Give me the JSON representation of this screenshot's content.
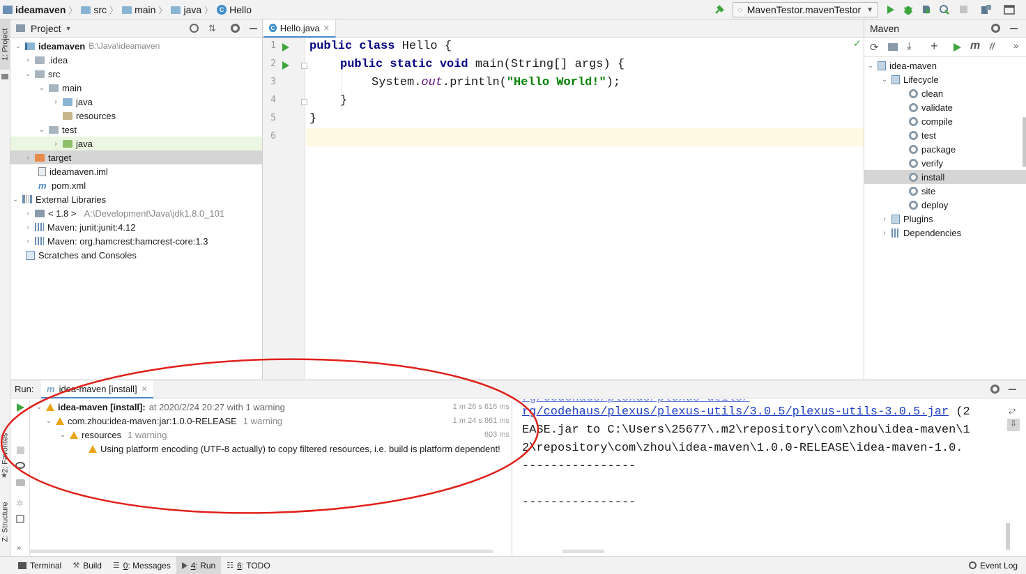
{
  "nav": {
    "project": "ideamaven",
    "crumbs": [
      "src",
      "main",
      "java",
      "Hello"
    ],
    "run_config": "MavenTestor.mavenTestor"
  },
  "left_tabs": {
    "project": "1: Project",
    "favorites": "2: Favorites",
    "structure": "Z: Structure"
  },
  "project_panel": {
    "title": "Project",
    "root": {
      "name": "ideamaven",
      "path": "B:\\Java\\ideamaven"
    },
    "items": {
      "idea": ".idea",
      "src": "src",
      "main": "main",
      "java": "java",
      "resources": "resources",
      "test": "test",
      "test_java": "java",
      "target": "target",
      "iml": "ideamaven.iml",
      "pom": "pom.xml",
      "extlib": "External Libraries",
      "jdk": "< 1.8 >",
      "jdk_path": "A:\\Development\\Java\\jdk1.8.0_101",
      "junit": "Maven: junit:junit:4.12",
      "hamcrest": "Maven: org.hamcrest:hamcrest-core:1.3",
      "scratches": "Scratches and Consoles"
    }
  },
  "editor": {
    "tab": "Hello.java",
    "line_numbers": [
      "1",
      "2",
      "3",
      "4",
      "5",
      "6"
    ],
    "code": {
      "l1_kw": "public class",
      "l1_rest": " Hello {",
      "l2_kw": "public static void",
      "l2_rest": " main(String[] args) {",
      "l3_a": "System.",
      "l3_field": "out",
      "l3_b": ".println(",
      "l3_str": "\"Hello World!\"",
      "l3_c": ");",
      "l4": "}",
      "l5": "}"
    }
  },
  "maven_panel": {
    "title": "Maven",
    "project": "idea-maven",
    "lifecycle": "Lifecycle",
    "phases": [
      "clean",
      "validate",
      "compile",
      "test",
      "package",
      "verify",
      "install",
      "site",
      "deploy"
    ],
    "selected": "install",
    "plugins": "Plugins",
    "dependencies": "Dependencies"
  },
  "run": {
    "label": "Run:",
    "tab": "idea-maven [install]",
    "rows": {
      "r1_bold": "idea-maven [install]:",
      "r1_rest": "at 2020/2/24 20:27 with 1 warning",
      "r1_time": "1 m 26 s 616 ms",
      "r2": "com.zhou:idea-maven:jar:1.0.0-RELEASE",
      "r2_note": "1 warning",
      "r2_time": "1 m 24 s 861 ms",
      "r3": "resources",
      "r3_note": "1 warning",
      "r3_time": "603 ms",
      "r4": "Using platform encoding (UTF-8 actually) to copy filtered resources, i.e. build is platform dependent!"
    },
    "console": {
      "c1": "rg/codehaus/plexus/plexus-utils/3.0.5/plexus-utils-3.0.5.jar",
      "c1_tail": " (2",
      "c2": "EASE.jar to C:\\Users\\25677\\.m2\\repository\\com\\zhou\\idea-maven\\1",
      "c3": "2\\repository\\com\\zhou\\idea-maven\\1.0.0-RELEASE\\idea-maven-1.0.",
      "c4": "----------------",
      "c5": "----------------"
    }
  },
  "bottom": {
    "terminal": "Terminal",
    "build": "Build",
    "messages_num": "0",
    "messages": ": Messages",
    "run_num": "4",
    "run": ": Run",
    "todo_num": "6",
    "todo": ": TODO",
    "event_log": "Event Log"
  },
  "colors": {
    "annotation": "#e0201a",
    "run_green": "#3ca63c",
    "selection": "#d5d5d5",
    "current_line": "#fffae3"
  }
}
